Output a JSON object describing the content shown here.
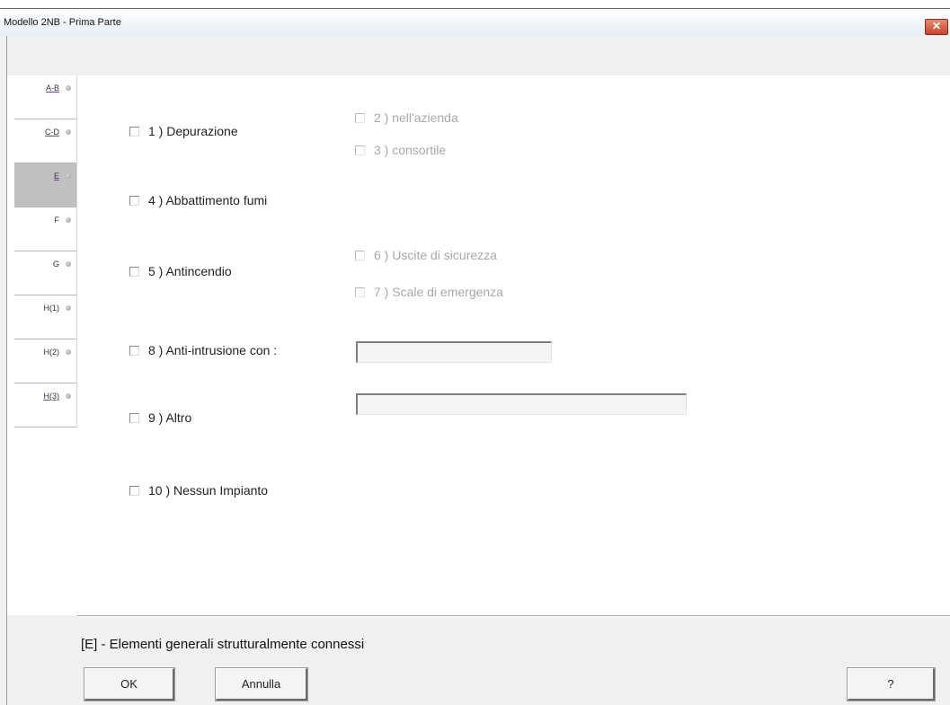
{
  "window": {
    "title": "Modello 2NB - Prima Parte",
    "close_symbol": "✕"
  },
  "tabs": [
    {
      "label": "A-B"
    },
    {
      "label": "C-D"
    },
    {
      "label": "E"
    },
    {
      "label": "F"
    },
    {
      "label": "G"
    },
    {
      "label": "H(1)"
    },
    {
      "label": "H(2)"
    },
    {
      "label": "H(3)"
    }
  ],
  "options": {
    "opt1": "1 ) Depurazione",
    "opt2": "2 ) nell'azienda",
    "opt3": "3 ) consortile",
    "opt4": "4 ) Abbattimento fumi",
    "opt5": "5 ) Antincendio",
    "opt6": "6 ) Uscite di sicurezza",
    "opt7": "7 ) Scale di emergenza",
    "opt8": "8 ) Anti-intrusione con :",
    "opt9": "9 ) Altro",
    "opt10": "10 ) Nessun Impianto"
  },
  "fields": {
    "anti_intrusione_value": "",
    "altro_value": ""
  },
  "section_title": "[E] - Elementi generali strutturalmente connessi",
  "buttons": {
    "ok": "OK",
    "annulla": "Annulla",
    "help": "?"
  }
}
